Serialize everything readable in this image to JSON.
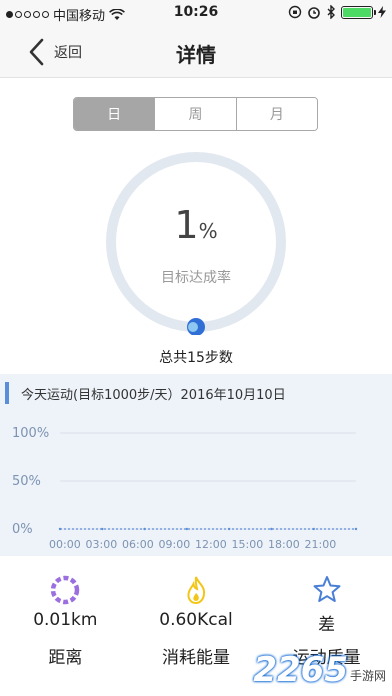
{
  "status_bar": {
    "carrier": "中国移动",
    "time": "10:26"
  },
  "nav": {
    "back_label": "返回",
    "title": "详情"
  },
  "tabs": [
    {
      "label": "日",
      "active": true
    },
    {
      "label": "周",
      "active": false
    },
    {
      "label": "月",
      "active": false
    }
  ],
  "progress": {
    "value": "1",
    "unit": "%",
    "fraction": 0.01,
    "label": "目标达成率",
    "total_steps": "总共15步数"
  },
  "chart_header": "今天运动(目标1000步/天）2016年10月10日",
  "chart_data": {
    "type": "line",
    "y_ticks": [
      "100%",
      "50%",
      "0%"
    ],
    "ylim": [
      0,
      100
    ],
    "x_ticks": [
      "00:00",
      "03:00",
      "06:00",
      "09:00",
      "12:00",
      "15:00",
      "18:00",
      "21:00"
    ],
    "series": [
      {
        "values": [
          0,
          0,
          0,
          0,
          0,
          0,
          0,
          0
        ]
      }
    ],
    "grid": true
  },
  "stats": [
    {
      "value": "0.01km",
      "label": "距离",
      "icon": "distance-ring-icon",
      "color": "#9b6fe0"
    },
    {
      "value": "0.60Kcal",
      "label": "消耗能量",
      "icon": "flame-icon",
      "color": "#f2c617"
    },
    {
      "value": "差",
      "label": "运动质量",
      "icon": "star-icon",
      "color": "#4a7fd6"
    }
  ],
  "watermark": {
    "big": "2265",
    "small": "手游网"
  },
  "colors": {
    "ring_track": "#e2e8f0",
    "ring_knob": "#2f6fd6",
    "accent": "#5b8ed8",
    "chart_bg": "#eef3f9"
  }
}
